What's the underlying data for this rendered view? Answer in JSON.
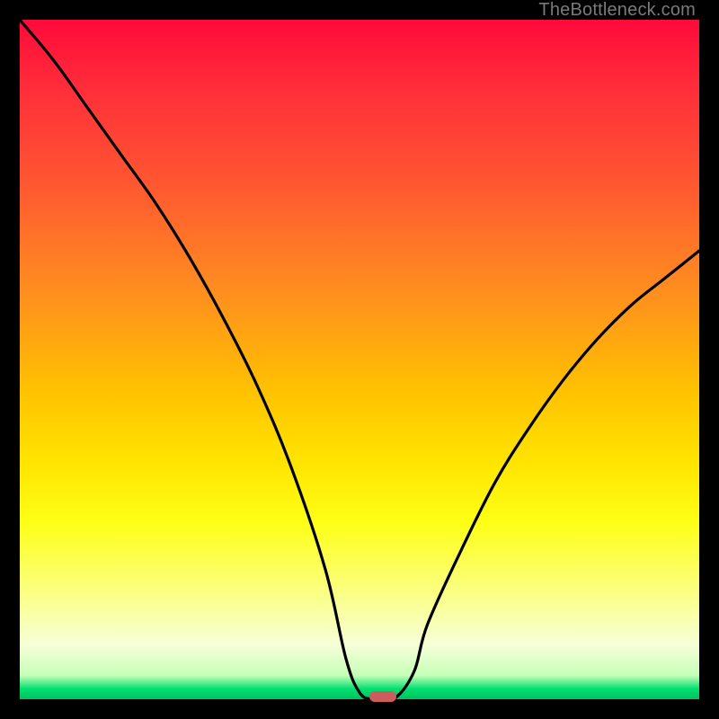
{
  "watermark": "TheBottleneck.com",
  "colors": {
    "frame": "#000000",
    "curve_stroke": "#000000",
    "marker": "#cd5c5c",
    "gradient_top": "#ff0a3a",
    "gradient_bottom": "#00c060"
  },
  "chart_data": {
    "type": "line",
    "title": "",
    "xlabel": "",
    "ylabel": "",
    "xlim": [
      0,
      100
    ],
    "ylim": [
      0,
      100
    ],
    "grid": false,
    "series": [
      {
        "name": "bottleneck-curve",
        "x": [
          0,
          5,
          10,
          15,
          20,
          25,
          30,
          35,
          40,
          45,
          48,
          50,
          52,
          55,
          58,
          60,
          65,
          70,
          75,
          80,
          85,
          90,
          95,
          100
        ],
        "values": [
          100,
          94,
          87,
          80,
          73,
          65,
          56,
          46,
          34,
          19,
          6,
          1,
          0,
          0,
          4,
          11,
          22,
          32,
          40,
          47,
          53,
          58,
          62,
          66
        ]
      }
    ],
    "marker": {
      "x": 53.5,
      "y": 0,
      "shape": "pill",
      "color": "#cd5c5c"
    }
  }
}
